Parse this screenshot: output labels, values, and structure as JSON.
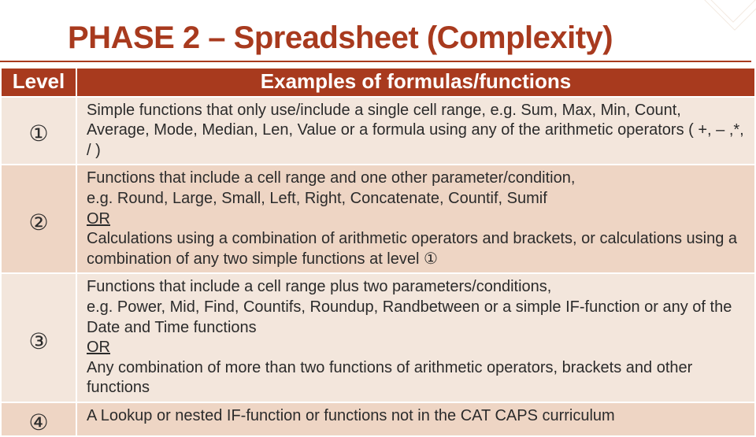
{
  "title": "PHASE 2 – Spreadsheet (Complexity)",
  "header": {
    "level": "Level",
    "examples": "Examples of formulas/functions"
  },
  "or_text": "OR",
  "rows": [
    {
      "level": "①",
      "text": "Simple functions that only use/include a single cell range, e.g. Sum, Max, Min, Count, Average, Mode, Median, Len, Value or a formula using any of the arithmetic operators ( +, – ,*, / )"
    },
    {
      "level": "②",
      "pre": "Functions that include a cell range and one other parameter/condition,\ne.g. Round, Large, Small, Left, Right, Concatenate, Countif, Sumif",
      "post": "Calculations using a combination of arithmetic operators and brackets, or calculations using a combination of any two simple functions at level ①"
    },
    {
      "level": "③",
      "pre": "Functions that include a cell range plus two parameters/conditions,\ne.g. Power, Mid, Find, Countifs, Roundup, Randbetween or a simple IF-function or any of the Date and Time functions",
      "post": "Any combination of more than two functions of arithmetic operators, brackets and other functions"
    },
    {
      "level": "④",
      "text": "A Lookup or nested IF-function or functions not in the CAT CAPS curriculum"
    }
  ]
}
